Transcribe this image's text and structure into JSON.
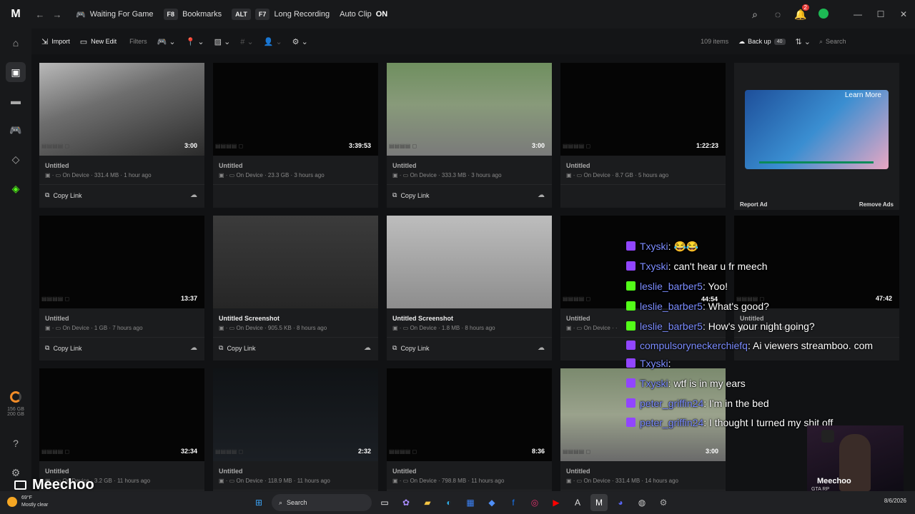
{
  "titlebar": {
    "logo": "M",
    "back": "←",
    "forward": "→",
    "game_status": "Waiting For Game",
    "bookmarks_key": "F8",
    "bookmarks_label": "Bookmarks",
    "alt_key": "ALT",
    "long_key": "F7",
    "long_label": "Long Recording",
    "autoclip_label": "Auto Clip",
    "autoclip_state": "ON",
    "notification_count": "2"
  },
  "toolbar": {
    "import_label": "Import",
    "new_edit_label": "New Edit",
    "filters_label": "Filters",
    "items_count": "109 items",
    "backup_label": "Back up",
    "backup_count": "40",
    "search_placeholder": "Search"
  },
  "sidebar": {
    "storage_used": "156 GB",
    "storage_total": "200 GB"
  },
  "cards": [
    {
      "title": "Untitled",
      "location": "On Device",
      "size": "331.4 MB",
      "time": "1 hour ago",
      "duration": "3:00",
      "copy": "Copy Link"
    },
    {
      "title": "Untitled",
      "location": "On Device",
      "size": "23.3 GB",
      "time": "3 hours ago",
      "duration": "3:39:53",
      "copy": ""
    },
    {
      "title": "Untitled",
      "location": "On Device",
      "size": "333.3 MB",
      "time": "3 hours ago",
      "duration": "3:00",
      "copy": "Copy Link"
    },
    {
      "title": "Untitled",
      "location": "On Device",
      "size": "8.7 GB",
      "time": "5 hours ago",
      "duration": "1:22:23",
      "copy": ""
    },
    {
      "title": "Untitled",
      "location": "On Device",
      "size": "1 GB",
      "time": "7 hours ago",
      "duration": "13:37",
      "copy": "Copy Link"
    },
    {
      "title": "Untitled Screenshot",
      "location": "On Device",
      "size": "905.5 KB",
      "time": "8 hours ago",
      "duration": "",
      "copy": "Copy Link"
    },
    {
      "title": "Untitled Screenshot",
      "location": "On Device",
      "size": "1.8 MB",
      "time": "8 hours ago",
      "duration": "",
      "copy": "Copy Link"
    },
    {
      "title": "Untitled",
      "location": "On Device",
      "size": "",
      "time": "",
      "duration": "",
      "copy": ""
    },
    {
      "title": "Untitled",
      "location": "",
      "size": "",
      "time": "11 hours ago",
      "duration": "47:42",
      "copy": ""
    },
    {
      "title": "Untitled",
      "location": "On Device",
      "size": "3.2 GB",
      "time": "11 hours ago",
      "duration": "32:34",
      "copy": ""
    },
    {
      "title": "Untitled",
      "location": "On Device",
      "size": "118.9 MB",
      "time": "11 hours ago",
      "duration": "2:32",
      "copy": ""
    },
    {
      "title": "Untitled",
      "location": "On Device",
      "size": "798.8 MB",
      "time": "11 hours ago",
      "duration": "8:36",
      "copy": ""
    },
    {
      "title": "Untitled",
      "location": "On Device",
      "size": "331.4 MB",
      "time": "14 hours ago",
      "duration": "3:00",
      "copy": ""
    }
  ],
  "ad": {
    "learn_more": "Learn More",
    "report": "Report Ad",
    "remove": "Remove Ads"
  },
  "overlay_time": "44:54",
  "chat": [
    {
      "platform": "twitch",
      "user": "Txyski",
      "msg": "😂😂"
    },
    {
      "platform": "twitch",
      "user": "Txyski",
      "msg": "can't hear u fr meech"
    },
    {
      "platform": "kick",
      "user": "leslie_barber5",
      "msg": "Yoo!"
    },
    {
      "platform": "kick",
      "user": "leslie_barber5",
      "msg": "What's good?"
    },
    {
      "platform": "kick",
      "user": "leslie_barber5",
      "msg": "How's your night going?"
    },
    {
      "platform": "twitch",
      "user": "compulsoryneckerchiefq",
      "msg": "Ai viewers streamboo. com"
    },
    {
      "platform": "twitch",
      "user": "Txyski",
      "msg": ""
    },
    {
      "platform": "twitch",
      "user": "Txyski",
      "msg": "wtf is in my ears"
    },
    {
      "platform": "twitch",
      "user": "peter_griffin24",
      "msg": "I'm in the bed"
    },
    {
      "platform": "twitch",
      "user": "peter_griffin24",
      "msg": "I thought I turned my shit off"
    }
  ],
  "webcam": {
    "name": "Meechoo",
    "sub": "GTA RP"
  },
  "streamer_name": "Meechoo",
  "taskbar": {
    "temp": "69°F",
    "weather": "Mostly clear",
    "search": "Search",
    "date": "8/6/2026"
  },
  "colors": {
    "accent_green": "#1db954",
    "twitch_purple": "#9146ff",
    "kick_green": "#53fc18",
    "chat_username": "#7b8cff",
    "storage_orange": "#f28c28"
  }
}
